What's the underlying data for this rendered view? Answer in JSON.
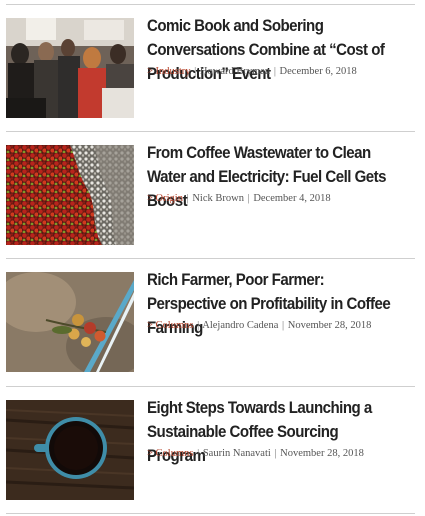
{
  "articles": [
    {
      "title": "Comic Book and Sobering Conversations Combine at “Cost of Production” Event",
      "category": "> Industry",
      "author": "Howard Bryman",
      "date": "December 6, 2018",
      "separator": "|"
    },
    {
      "title": "From Coffee Wastewater to Clean Water and Electricity: Fuel Cell Gets Boost",
      "category": "> Origin",
      "author": "Nick Brown",
      "date": "December 4, 2018",
      "separator": "|"
    },
    {
      "title": "Rich Farmer, Poor Farmer: Perspective on Profitability in Coffee Farming",
      "category": "> Columns",
      "author": "Alejandro Cadena",
      "date": "November 28, 2018",
      "separator": "|"
    },
    {
      "title": "Eight Steps Towards Launching a Sustainable Coffee Sourcing Program",
      "category": "> Columns",
      "author": "Saurin Nanavati",
      "date": "November 28, 2018",
      "separator": "|"
    }
  ],
  "colors": {
    "category": "#b5442c",
    "title": "#222222",
    "meta": "#555555",
    "rule": "#cfcfcf"
  }
}
